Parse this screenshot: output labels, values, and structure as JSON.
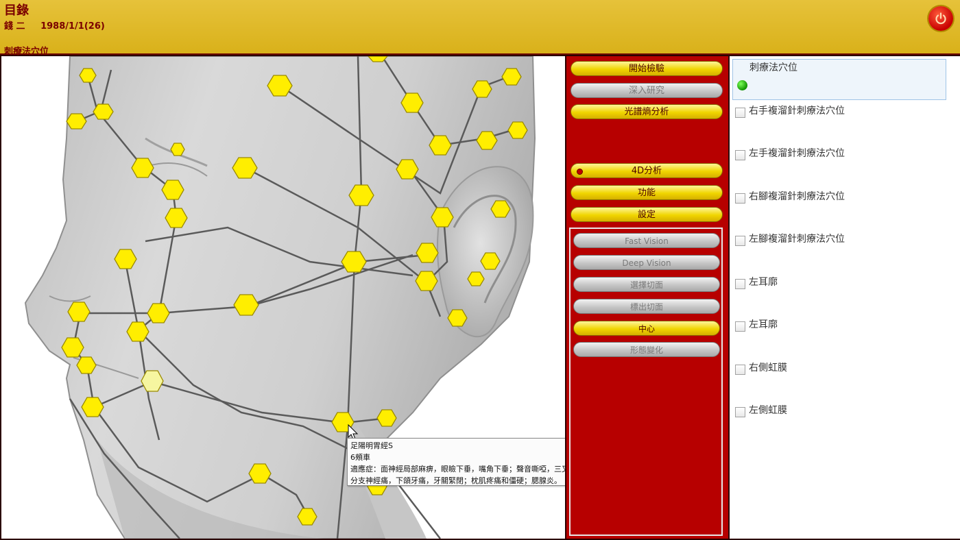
{
  "header": {
    "title": "目錄",
    "patient_name": "錢 二",
    "patient_dob": "1988/1/1(26)",
    "section": "刺療法穴位"
  },
  "colors": {
    "accent_red": "#b70000",
    "header_gold": "#dcb520",
    "acupoint_yellow": "#ffee00"
  },
  "icons": {
    "power": "power-icon",
    "cursor": "arrow-cursor-icon"
  },
  "tooltip": {
    "line1": "足陽明胃經S",
    "line2": "6頰車",
    "line3": "適應症：面神經局部麻痹，眼瞼下垂，嘴角下垂；聲音嘶啞，三叉神經痛III",
    "line4": "分支神經痛，下頜牙痛，牙關緊閉；枕肌疼痛和僵硬；腮腺炎。"
  },
  "menu": {
    "start_test": "開始檢驗",
    "deep_research": "深入研究",
    "spectral_analysis": "光譜熵分析",
    "analysis_4d": "4D分析",
    "functions": "功能",
    "settings": "設定"
  },
  "submenu": {
    "fast_vision": "Fast Vision",
    "deep_vision": "Deep Vision",
    "select_slice": "選擇切面",
    "mark_slice": "標出切面",
    "center": "中心",
    "morph": "形態變化"
  },
  "list": {
    "selected_label": "刺療法穴位",
    "items": [
      "右手複溜針刺療法穴位",
      "左手複溜針刺療法穴位",
      "右腳複溜針刺療法穴位",
      "左腳複溜針刺療法穴位",
      "左耳廓",
      "左耳廓",
      "右側虹膜",
      "左側虹膜"
    ]
  }
}
